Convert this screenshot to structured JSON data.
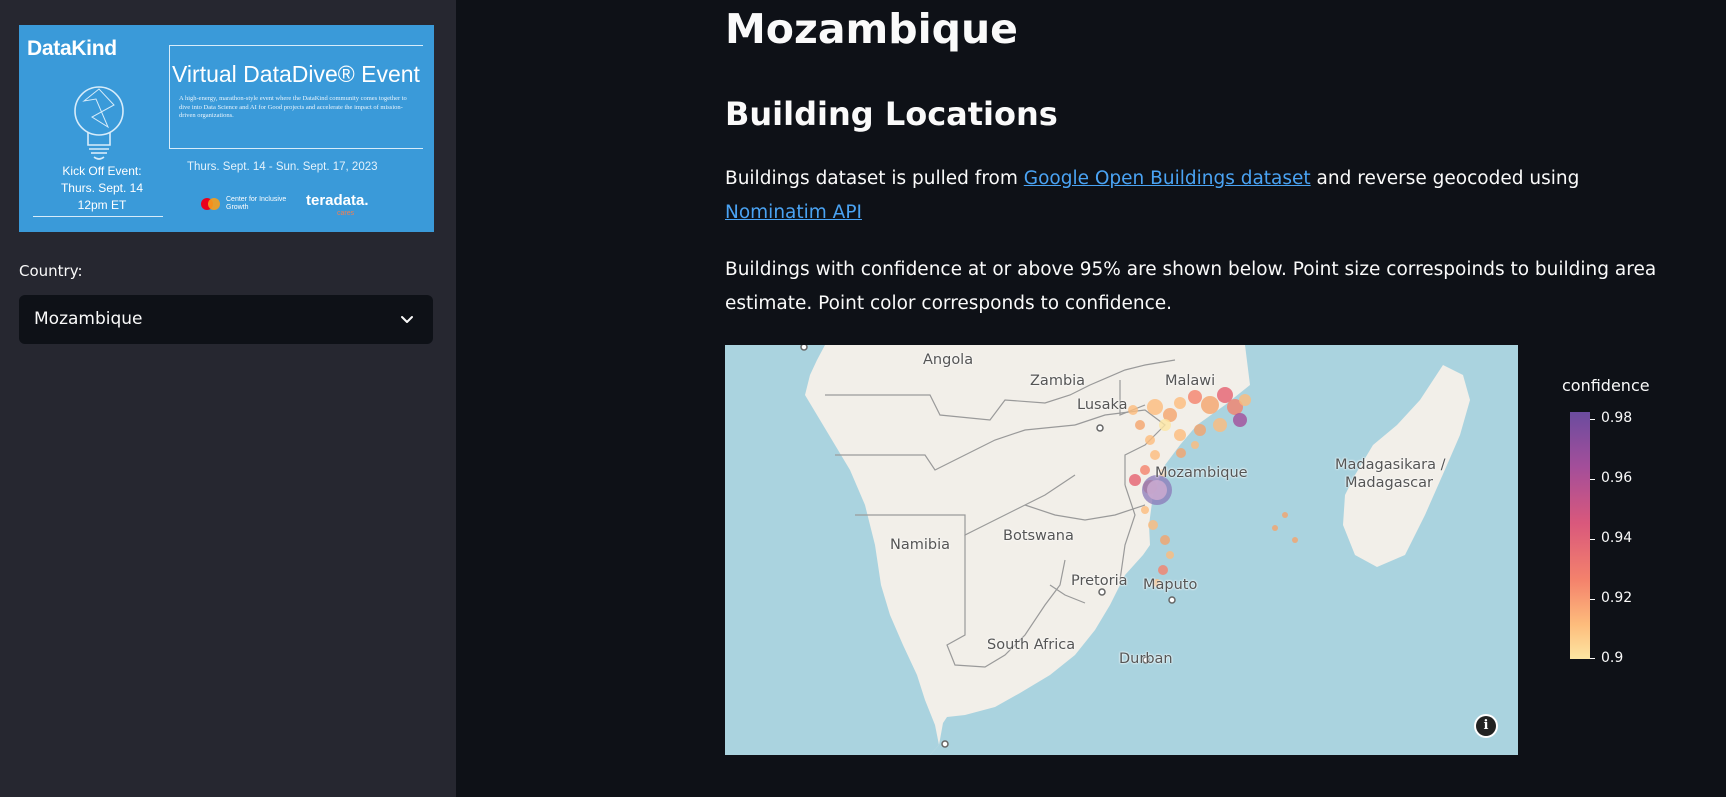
{
  "sidebar": {
    "banner": {
      "logo": "DataKind",
      "event_title": "Virtual DataDive® Event",
      "event_description": "A high-energy, marathon-style event where the DataKind community comes together to dive into Data Science and AI for Good projects and accelerate the impact of mission-driven organizations.",
      "kickoff_lines": [
        "Kick Off Event:",
        "Thurs. Sept. 14",
        "12pm ET"
      ],
      "dates": "Thurs. Sept. 14 - Sun. Sept. 17, 2023",
      "sponsor1": "Center for Inclusive Growth",
      "sponsor2": "teradata.",
      "sponsor2_sub": "cares"
    },
    "country_label": "Country:",
    "country_value": "Mozambique"
  },
  "main": {
    "title": "Mozambique",
    "section_title": "Building Locations",
    "para1": {
      "before": "Buildings dataset is pulled from ",
      "link1": "Google Open Buildings dataset",
      "middle": " and reverse geocoded using ",
      "link2": "Nominatim API"
    },
    "para2": "Buildings with confidence at or above 95% are shown below. Point size correspoinds to building area estimate. Point color corresponds to confidence."
  },
  "map": {
    "labels": [
      "Angola",
      "Zambia",
      "Malawi",
      "Lusaka",
      "Mozambique",
      "Madagasikara /",
      "Madagascar",
      "Namibia",
      "Botswana",
      "Pretoria",
      "Maputo",
      "South Africa",
      "Durban"
    ],
    "info_glyph": "i",
    "colors": {
      "ocean": "#aad3df",
      "land": "#f2efe9",
      "border": "#9a9a9a"
    }
  },
  "legend": {
    "title": "confidence",
    "ticks": [
      "0.98",
      "0.96",
      "0.94",
      "0.92",
      "0.9"
    ],
    "colorscale": [
      "#6b4c9f",
      "#a34e9a",
      "#d9587c",
      "#f4826c",
      "#fdbc7c",
      "#fde6a2"
    ]
  }
}
